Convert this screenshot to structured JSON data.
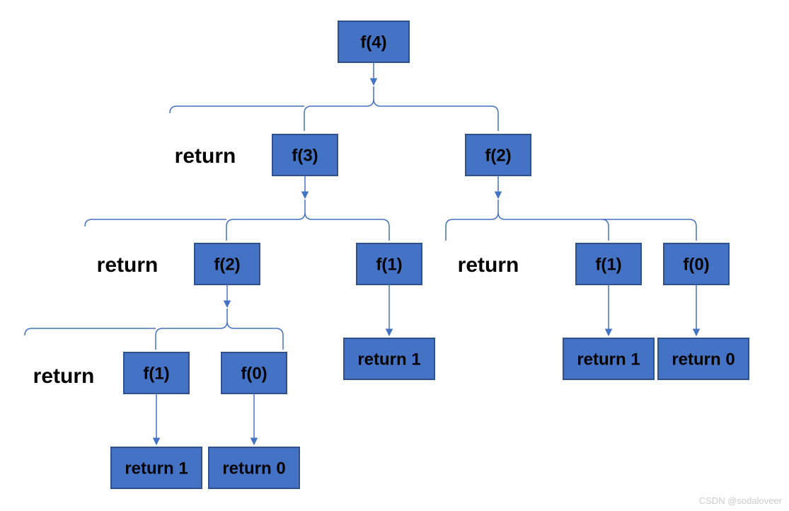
{
  "root": {
    "label": "f(4)"
  },
  "level1": {
    "return_label": "return",
    "left": {
      "label": "f(3)"
    },
    "right": {
      "label": "f(2)"
    }
  },
  "level2_left": {
    "return_label": "return",
    "left": {
      "label": "f(2)"
    },
    "right": {
      "label": "f(1)"
    }
  },
  "level2_right": {
    "return_label": "return",
    "left": {
      "label": "f(1)"
    },
    "right": {
      "label": "f(0)"
    }
  },
  "level3_from_f2": {
    "return_label": "return",
    "left": {
      "label": "f(1)"
    },
    "right": {
      "label": "f(0)"
    }
  },
  "leaves": {
    "l2l_r_ret": "return 1",
    "l2r_l_ret": "return 1",
    "l2r_r_ret": "return 0",
    "l3_l_ret": "return 1",
    "l3_r_ret": "return 0"
  },
  "watermark": "CSDN @sodaloveer",
  "colors": {
    "box_fill": "#4472C4",
    "box_stroke": "#2F528F"
  }
}
